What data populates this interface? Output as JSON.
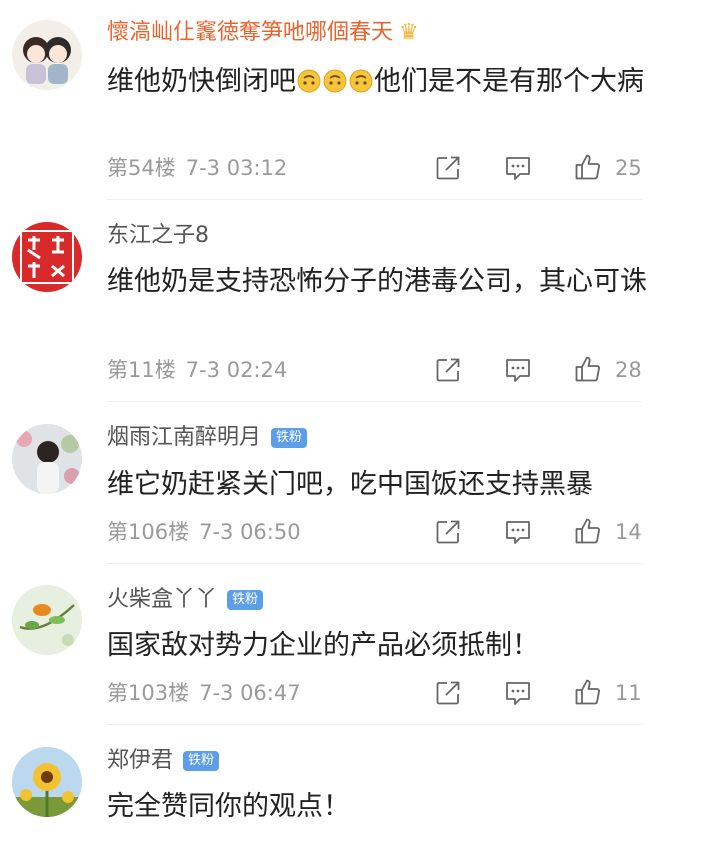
{
  "comments": [
    {
      "username": "懷滈屾仩竁徳奪笋吔哪個春天",
      "crown": "♛",
      "content_before": "维他奶快倒闭吧",
      "emoji_name": "upside-down-face-emoji",
      "content_after": "他们是不是有那个大病",
      "floor": "第54楼",
      "time": "7-3 03:12",
      "likes": "25"
    },
    {
      "username": "东江之子8",
      "content": "维他奶是支持恐怖分子的港毒公司，其心可诛",
      "floor": "第11楼",
      "time": "7-3 02:24",
      "likes": "28"
    },
    {
      "username": "烟雨江南醉明月",
      "badge": "铁粉",
      "content": "维它奶赶紧关门吧，吃中国饭还支持黑暴",
      "floor": "第106楼",
      "time": "7-3 06:50",
      "likes": "14"
    },
    {
      "username": "火柴盒丫丫",
      "badge": "铁粉",
      "content": "国家敌对势力企业的产品必须抵制！",
      "floor": "第103楼",
      "time": "7-3 06:47",
      "likes": "11"
    },
    {
      "username": "郑伊君",
      "badge": "铁粉",
      "content": "完全赞同你的观点！"
    }
  ],
  "colors": {
    "vip_name": "#e8632d",
    "name": "#555555",
    "badge_bg": "#5c9fe8",
    "meta": "#9a9a9a"
  },
  "icons": [
    "share-icon",
    "comment-icon",
    "like-icon"
  ]
}
